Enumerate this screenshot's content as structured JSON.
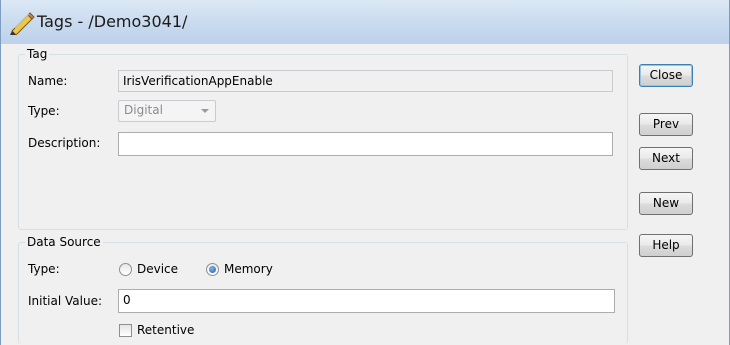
{
  "window": {
    "title": "Tags - /Demo3041/",
    "icon": "tag-pencil-icon"
  },
  "tag_group": {
    "legend": "Tag",
    "name_label": "Name:",
    "name_value": "IrisVerificationAppEnable",
    "type_label": "Type:",
    "type_value": "Digital",
    "description_label": "Description:",
    "description_value": ""
  },
  "data_source_group": {
    "legend": "Data Source",
    "type_label": "Type:",
    "options": [
      {
        "label": "Device",
        "selected": false
      },
      {
        "label": "Memory",
        "selected": true
      }
    ],
    "initial_value_label": "Initial Value:",
    "initial_value": "0",
    "retentive_label": "Retentive",
    "retentive_checked": false
  },
  "buttons": {
    "close": "Close",
    "prev": "Prev",
    "next": "Next",
    "new": "New",
    "help": "Help"
  },
  "colors": {
    "titlebar": "#c7d9ee",
    "window_bg": "#f0f0f0",
    "group_border": "#d5dfe5"
  }
}
